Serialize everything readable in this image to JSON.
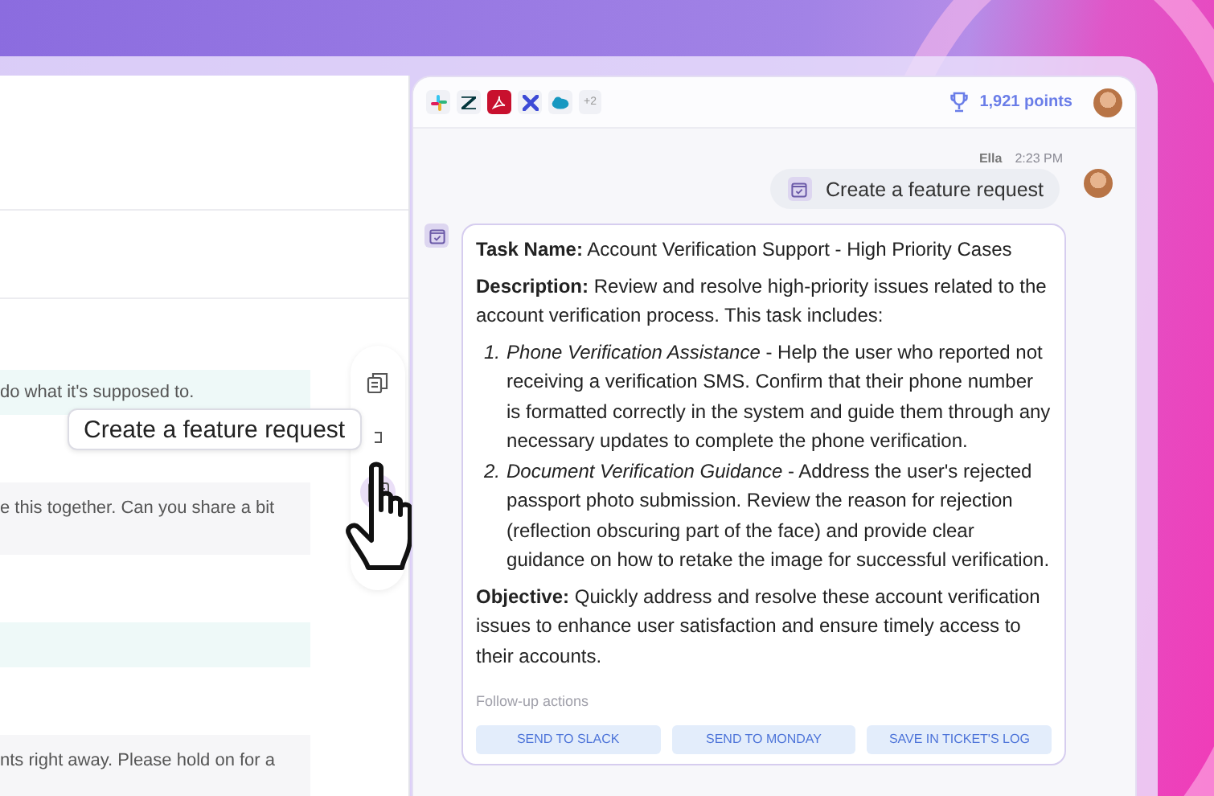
{
  "left_pane": {
    "messages": [
      {
        "kind": "customer",
        "text": "do what it's supposed to."
      },
      {
        "kind": "agent",
        "text": "e this together. Can you share a bit"
      },
      {
        "kind": "customer"
      },
      {
        "kind": "agent",
        "text": "nts right away. Please hold on for a"
      }
    ]
  },
  "toolbar": {
    "tooltip": "Create a feature request"
  },
  "chat": {
    "header": {
      "more_integrations": "+2",
      "points": "1,921 points"
    },
    "user_message": {
      "author": "Ella",
      "time": "2:23 PM",
      "text": "Create a feature request"
    },
    "reply": {
      "paragraphs_before": [
        "**Task Name:** Account Verification Support - High Priority Cases",
        "**Description:** Review and resolve high-priority issues related to the account verification process. This task includes:"
      ],
      "list": [
        {
          "number": "1.",
          "text": "*Phone Verification Assistance* - Help the user who reported not receiving a verification SMS. Confirm that their phone number is formatted correctly in the system and guide them through any necessary updates to complete the phone verification."
        },
        {
          "number": "2.",
          "text": "*Document Verification Guidance* - Address the user's rejected passport photo submission. Review the reason for rejection (reflection obscuring part of the face) and provide clear guidance on how to retake the image for successful verification."
        }
      ],
      "paragraphs_after": [
        "**Objective:** Quickly address and resolve these account verification issues to enhance user satisfaction and ensure timely access to their accounts."
      ],
      "follow_up_label": "Follow-up actions",
      "actions": [
        "SEND TO SLACK",
        "SEND TO MONDAY",
        "SAVE IN TICKET'S LOG"
      ]
    }
  }
}
